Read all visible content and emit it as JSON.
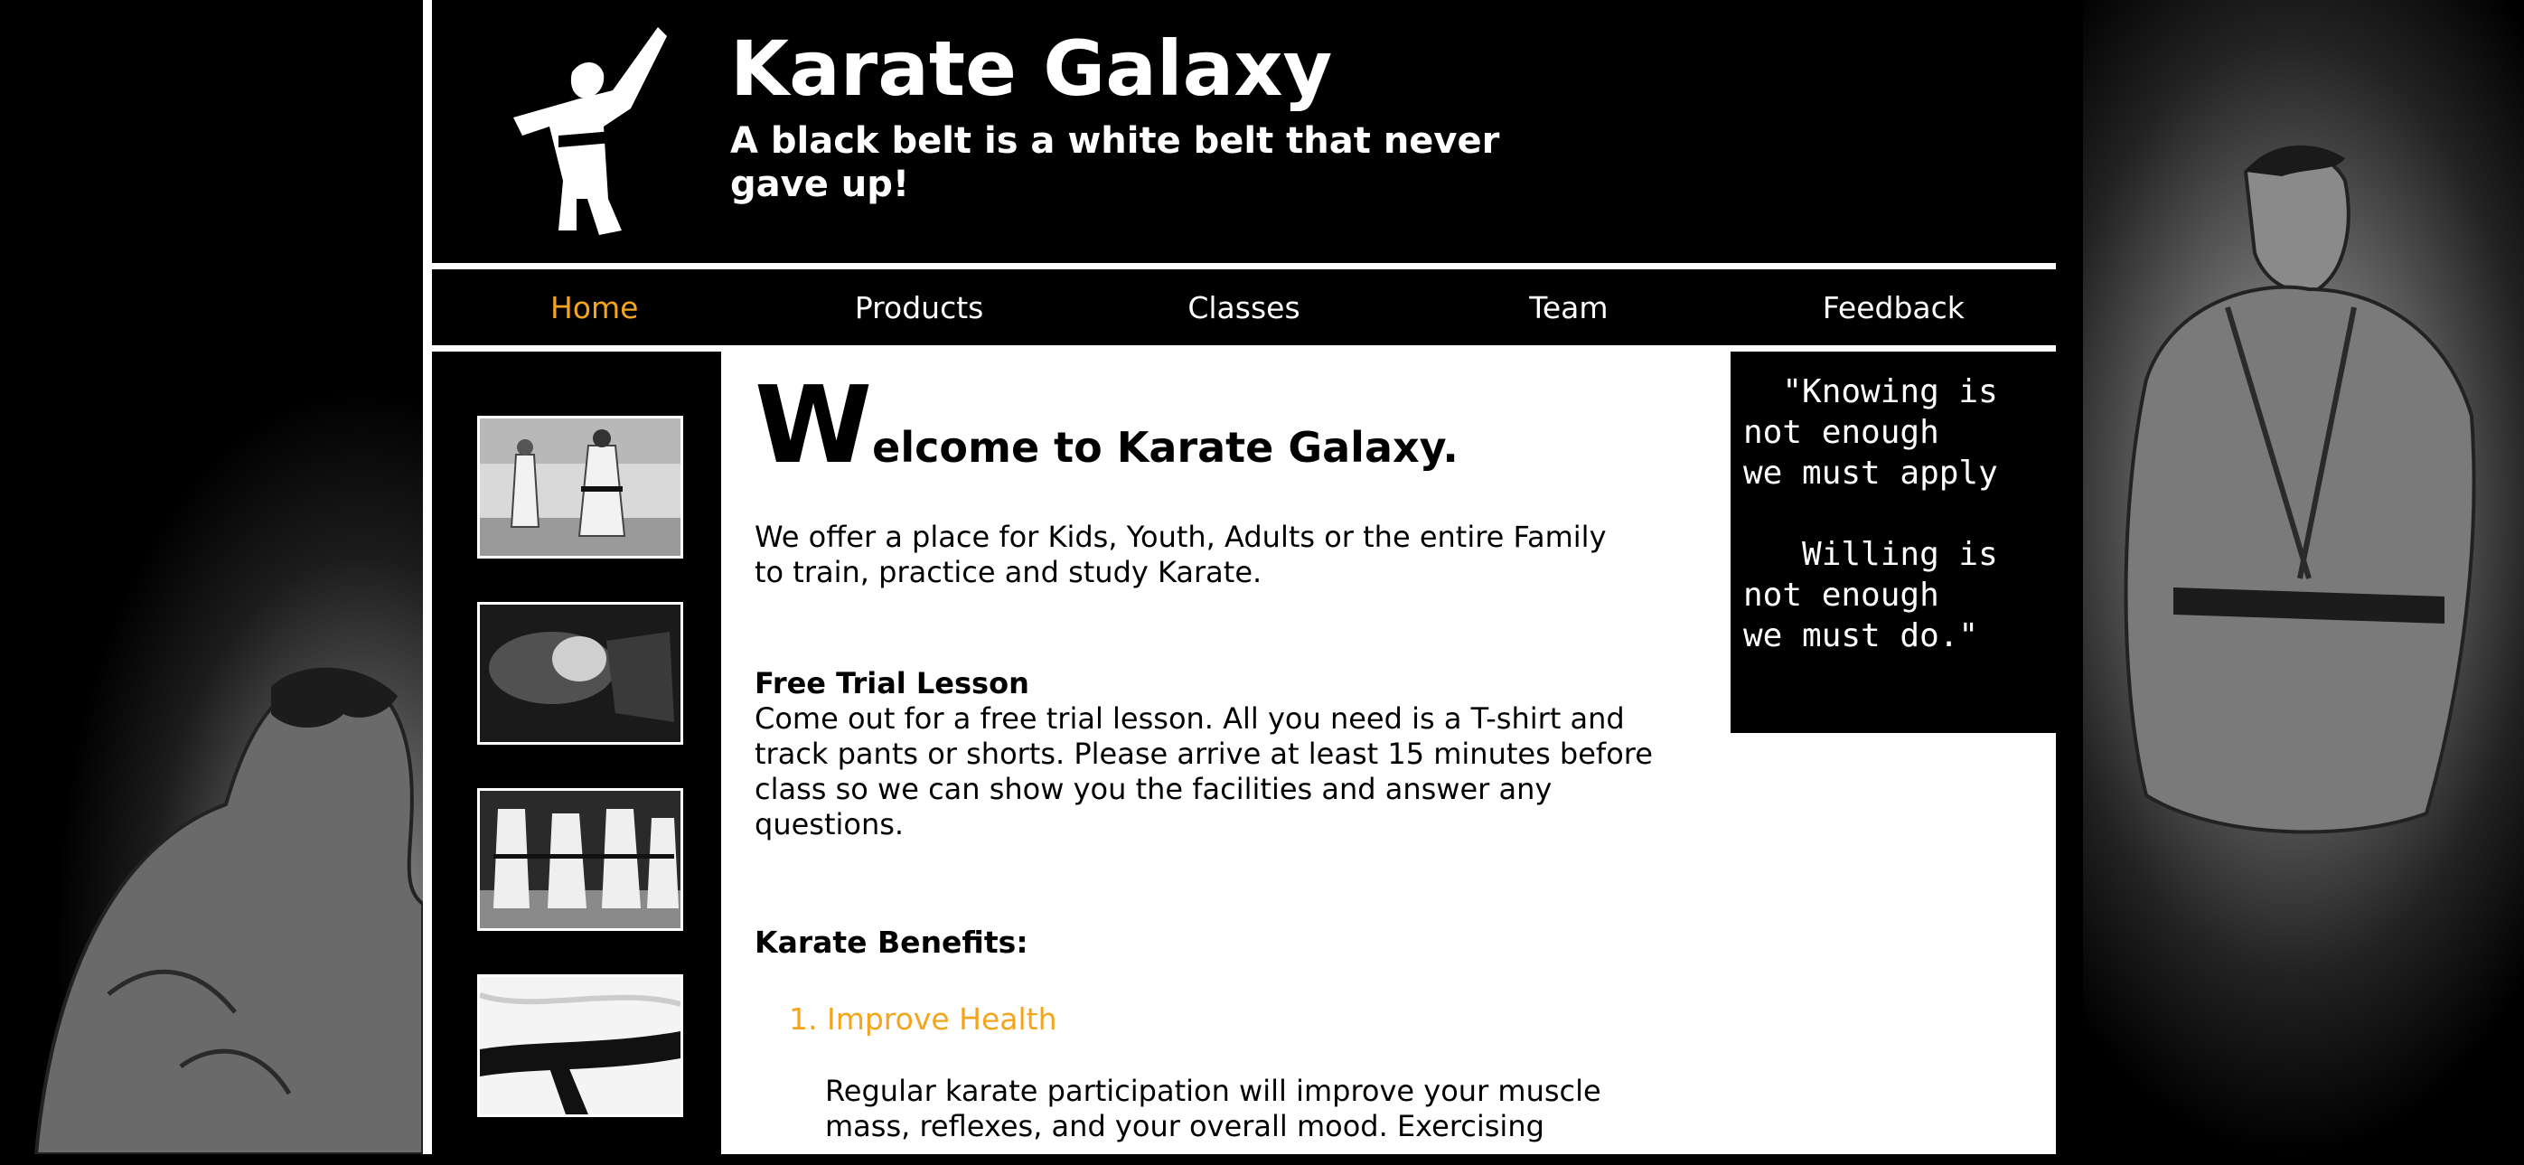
{
  "header": {
    "title": "Karate Galaxy",
    "tagline": "A black belt is a white belt that never gave up!"
  },
  "nav": {
    "items": [
      {
        "label": "Home",
        "active": true
      },
      {
        "label": "Products",
        "active": false
      },
      {
        "label": "Classes",
        "active": false
      },
      {
        "label": "Team",
        "active": false
      },
      {
        "label": "Feedback",
        "active": false
      }
    ]
  },
  "gallery": {
    "images": [
      "karate-sparring-photo",
      "smoke-fist-photo",
      "kata-class-photo",
      "black-belt-photo"
    ]
  },
  "main": {
    "welcome_dropcap": "W",
    "welcome_rest": "elcome to Karate Galaxy.",
    "intro": "We offer a place for Kids, Youth, Adults or the entire Family to train, practice and study Karate.",
    "free_trial_heading": "Free Trial Lesson",
    "free_trial_text": "Come out for a free trial lesson. All you need is a T-shirt and track pants or shorts. Please arrive at least 15 minutes before class so we can show you the facilities and answer any questions.",
    "benefits_heading": "Karate Benefits:",
    "benefit_1_title": "1. Improve Health",
    "benefit_1_text": "Regular karate participation will improve your muscle mass, reflexes, and your overall mood. Exercising"
  },
  "quote": {
    "text": "  \"Knowing is\nnot enough\nwe must apply\n\n   Willing is\nnot enough\nwe must do.\""
  },
  "colors": {
    "accent": "#f5a51c",
    "background": "#000000",
    "content_bg": "#ffffff"
  }
}
